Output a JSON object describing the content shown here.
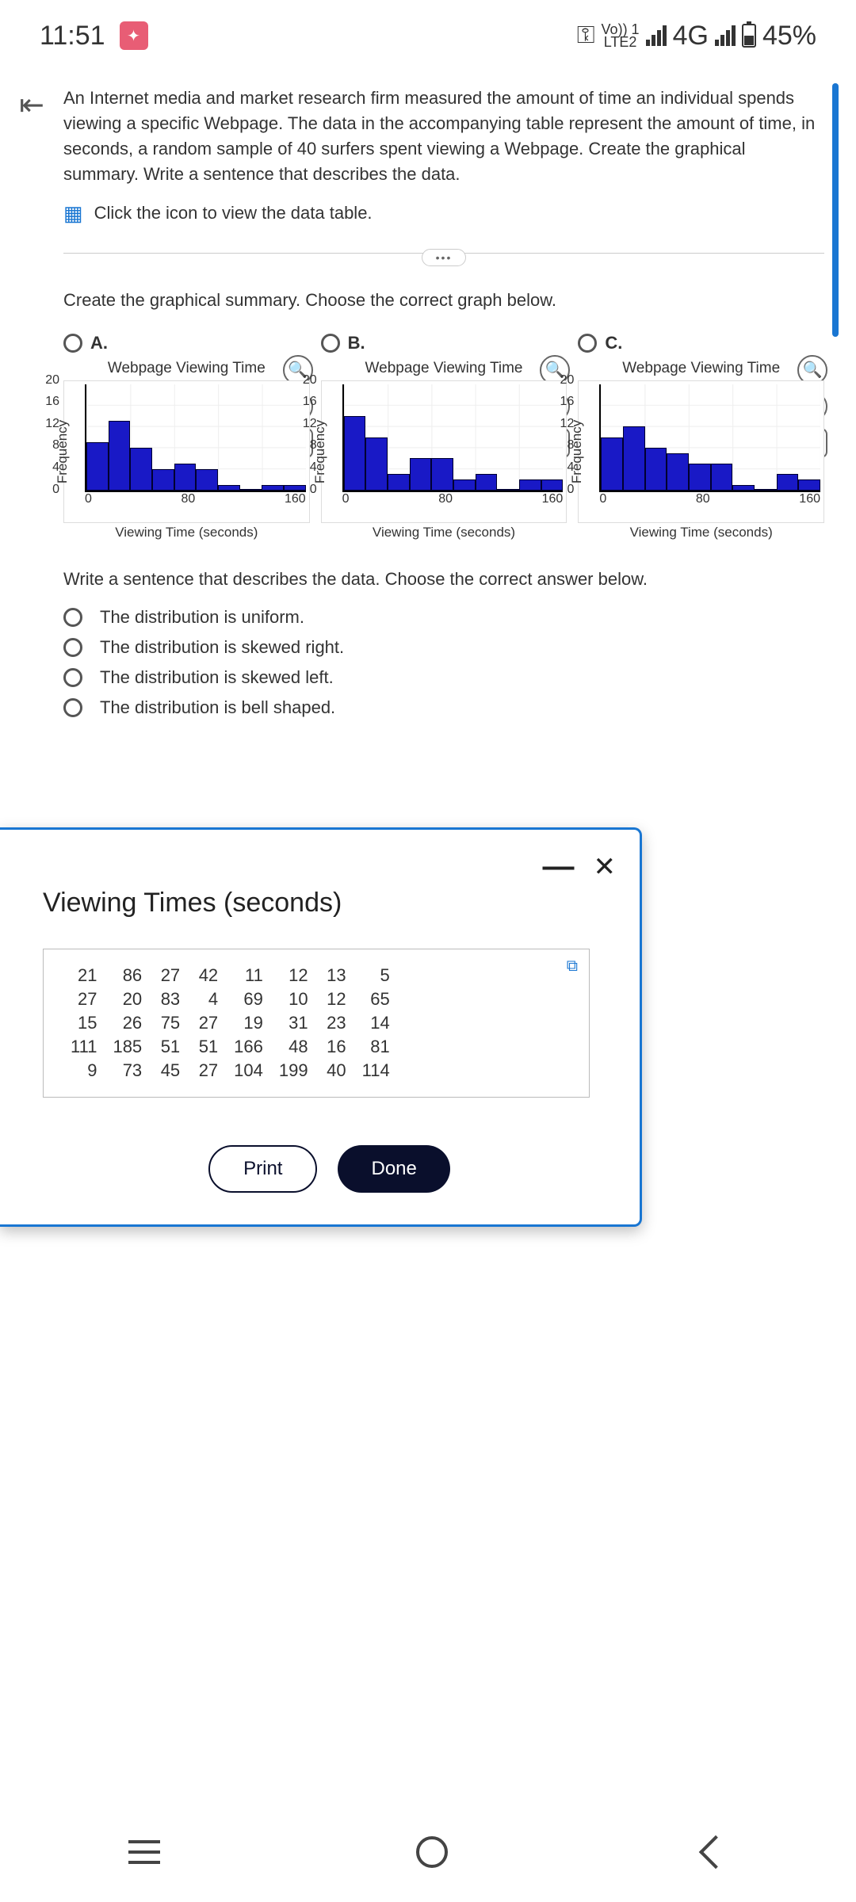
{
  "status": {
    "time": "11:51",
    "net_top": "Vo)) 1",
    "net_bottom": "LTE2",
    "net_label": "4G",
    "battery": "45%"
  },
  "question": {
    "intro": "An Internet media and market research firm measured the amount of time an individual spends viewing a specific Webpage. The data in the accompanying table represent the amount of time, in seconds, a random sample of 40 surfers spent viewing a Webpage. Create the graphical summary. Write a sentence that describes the data.",
    "table_hint": "Click the icon to view the data table.",
    "create_prompt": "Create the graphical summary. Choose the correct graph below.",
    "opt_a": "A.",
    "opt_b": "B.",
    "opt_c": "C.",
    "chart_title": "Webpage Viewing Time",
    "ylabel": "Frequency",
    "xlabel": "Viewing Time (seconds)",
    "sentence_prompt": "Write a sentence that describes the data. Choose the correct answer below.",
    "answers": {
      "a1": "The distribution is uniform.",
      "a2": "The distribution is skewed right.",
      "a3": "The distribution is skewed left.",
      "a4": "The distribution is bell shaped."
    }
  },
  "yticks": [
    "20",
    "16",
    "12",
    "8",
    "4",
    "0"
  ],
  "xticks": [
    "0",
    "80",
    "160"
  ],
  "chart_data": [
    {
      "id": "A",
      "type": "bar",
      "title": "Webpage Viewing Time",
      "xlabel": "Viewing Time (seconds)",
      "ylabel": "Frequency",
      "bin_edges": [
        0,
        20,
        40,
        60,
        80,
        100,
        120,
        140,
        160,
        180,
        200
      ],
      "values": [
        9,
        13,
        8,
        4,
        5,
        4,
        1,
        0,
        1,
        1
      ],
      "ylim": [
        0,
        20
      ]
    },
    {
      "id": "B",
      "type": "bar",
      "title": "Webpage Viewing Time",
      "xlabel": "Viewing Time (seconds)",
      "ylabel": "Frequency",
      "bin_edges": [
        0,
        20,
        40,
        60,
        80,
        100,
        120,
        140,
        160,
        180,
        200
      ],
      "values": [
        14,
        10,
        3,
        6,
        6,
        2,
        3,
        0,
        2,
        2
      ],
      "ylim": [
        0,
        20
      ]
    },
    {
      "id": "C",
      "type": "bar",
      "title": "Webpage Viewing Time",
      "xlabel": "Viewing Time (seconds)",
      "ylabel": "Frequency",
      "bin_edges": [
        0,
        20,
        40,
        60,
        80,
        100,
        120,
        140,
        160,
        180,
        200
      ],
      "values": [
        10,
        12,
        8,
        7,
        5,
        5,
        1,
        0,
        3,
        2
      ],
      "ylim": [
        0,
        20
      ]
    }
  ],
  "modal": {
    "title": "Viewing Times (seconds)",
    "print": "Print",
    "done": "Done",
    "rows": [
      [
        "21",
        "86",
        "27",
        "42",
        "11",
        "12",
        "13",
        "5"
      ],
      [
        "27",
        "20",
        "83",
        "4",
        "69",
        "10",
        "12",
        "65"
      ],
      [
        "15",
        "26",
        "75",
        "27",
        "19",
        "31",
        "23",
        "14"
      ],
      [
        "111",
        "185",
        "51",
        "51",
        "166",
        "48",
        "16",
        "81"
      ],
      [
        "9",
        "73",
        "45",
        "27",
        "104",
        "199",
        "40",
        "114"
      ]
    ]
  }
}
